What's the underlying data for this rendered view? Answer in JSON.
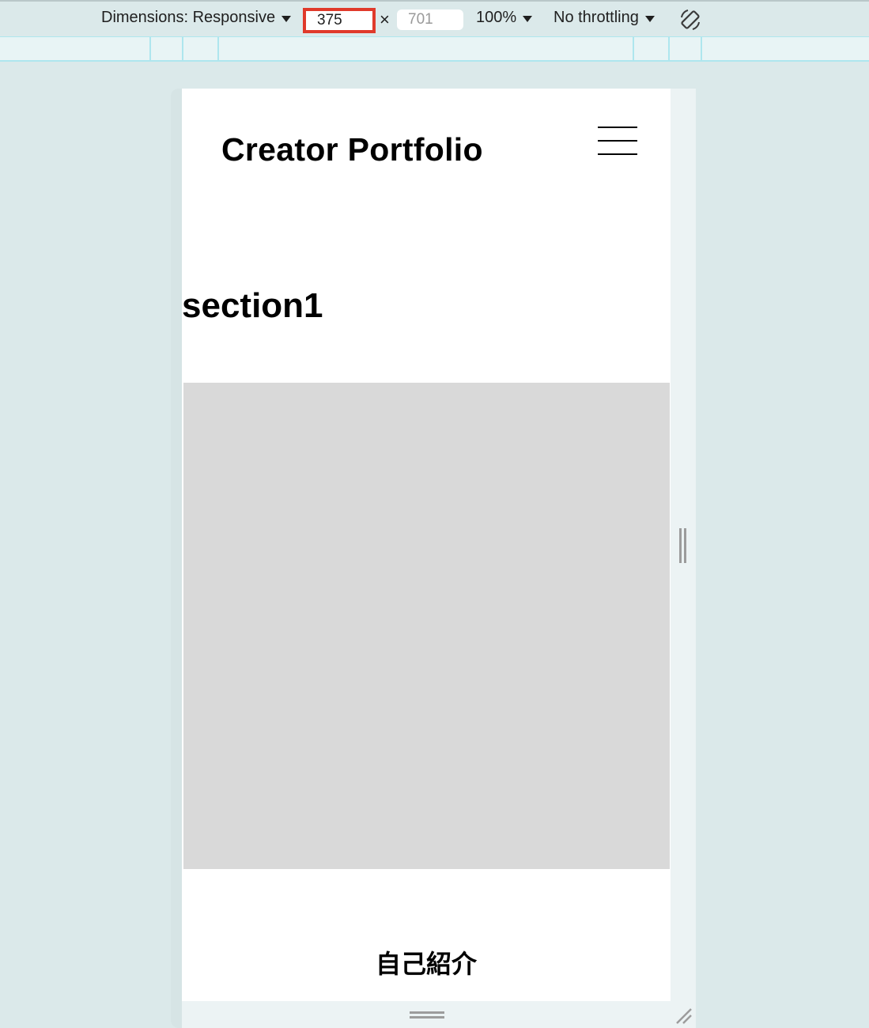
{
  "toolbar": {
    "dimensions_label": "Dimensions: Responsive",
    "width_value": "375",
    "times_symbol": "×",
    "height_value": "701",
    "zoom_label": "100%",
    "throttling_label": "No throttling",
    "rotate_icon": "rotate-device-icon"
  },
  "page": {
    "site_title": "Creator Portfolio",
    "menu_icon": "hamburger-menu-icon",
    "section_title": "section1",
    "intro_heading": "自己紹介"
  },
  "colors": {
    "highlight_border": "#e03a2b",
    "placeholder_gray": "#d9d9d9",
    "canvas_background": "#dbe9ea"
  }
}
